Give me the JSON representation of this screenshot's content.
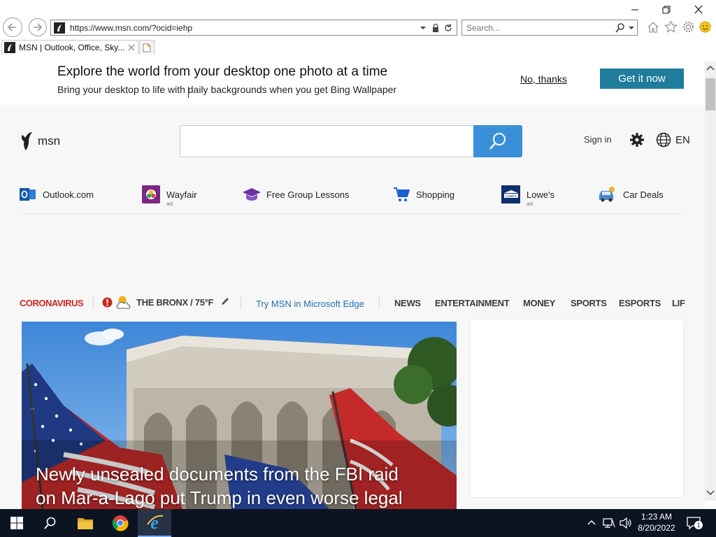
{
  "browser": {
    "url": "https://www.msn.com/?ocid=iehp",
    "search_placeholder": "Search...",
    "tab_title": "MSN | Outlook, Office, Sky..."
  },
  "banner": {
    "title": "Explore the world from your desktop one photo at a time",
    "subtitle": "Bring your desktop to life with daily backgrounds when you get Bing Wallpaper",
    "no_thanks": "No, thanks",
    "get_it": "Get it now"
  },
  "header": {
    "logo_text": "msn",
    "sign_in": "Sign in",
    "language": "EN"
  },
  "quicklinks": [
    {
      "label": "Outlook.com",
      "ad": ""
    },
    {
      "label": "Wayfair",
      "ad": "ad"
    },
    {
      "label": "Free Group Lessons",
      "ad": ""
    },
    {
      "label": "Shopping",
      "ad": ""
    },
    {
      "label": "Lowe's",
      "ad": "ad"
    },
    {
      "label": "Car Deals",
      "ad": ""
    }
  ],
  "nav": {
    "coronavirus": "CORONAVIRUS",
    "weather": "THE BRONX / 75°F",
    "edge": "Try MSN in Microsoft Edge",
    "items": [
      "NEWS",
      "ENTERTAINMENT",
      "MONEY",
      "SPORTS",
      "ESPORTS",
      "LIF"
    ]
  },
  "hero": {
    "headline_line1": "Newly unsealed documents from the FBI raid",
    "headline_line2": "on Mar-a-Lago put Trump in even worse legal"
  },
  "taskbar": {
    "time": "1:23 AM",
    "date": "8/20/2022",
    "notification_count": "1"
  },
  "colors": {
    "accent_blue": "#3a8fd9",
    "teal_button": "#1f7d9b",
    "coronavirus_red": "#c7281f",
    "taskbar": "#0c1422"
  }
}
